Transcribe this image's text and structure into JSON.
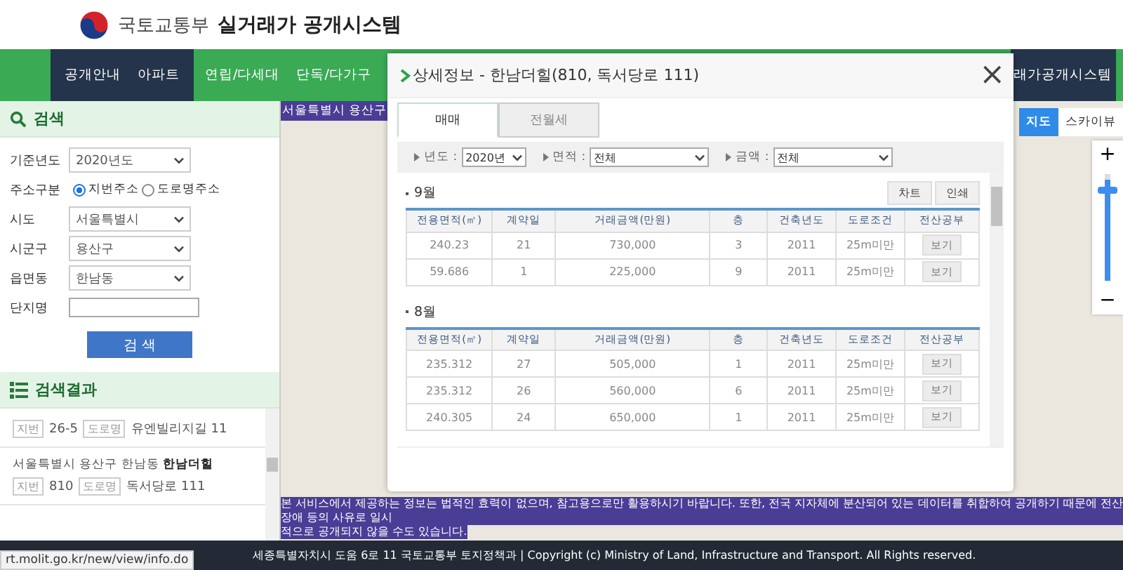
{
  "header": {
    "ministry": "국토교통부",
    "system": "실거래가 공개시스템"
  },
  "nav": {
    "items": [
      {
        "label": "공개안내",
        "selected": true
      },
      {
        "label": "아파트",
        "selected": true
      },
      {
        "label": "연립/다세대",
        "selected": false
      },
      {
        "label": "단독/다가구",
        "selected": false
      }
    ],
    "right_label": "래가공개시스템"
  },
  "search": {
    "title": "검색",
    "fields": [
      {
        "kind": "select",
        "label": "기준년도",
        "value": "2020년도"
      },
      {
        "kind": "radio",
        "label": "주소구분",
        "options": [
          {
            "label": "지번주소",
            "selected": true
          },
          {
            "label": "도로명주소",
            "selected": false
          }
        ]
      },
      {
        "kind": "select",
        "label": "시도",
        "value": "서울특별시"
      },
      {
        "kind": "select",
        "label": "시군구",
        "value": "용산구"
      },
      {
        "kind": "select",
        "label": "읍면동",
        "value": "한남동"
      },
      {
        "kind": "text",
        "label": "단지명"
      }
    ],
    "button": "검 색"
  },
  "results": {
    "title": "검색결과",
    "items": [
      {
        "lot_label": "지번",
        "lot": "26-5",
        "road_label": "도로명",
        "road": "유엔빌리지길 11"
      },
      {
        "address": "서울특별시 용산구 한남동 **한남더힐**",
        "lot_label": "지번",
        "lot": "810",
        "road_label": "도로명",
        "road": "독서당로 111"
      }
    ]
  },
  "map": {
    "top_notice": "서울특별시 용산구",
    "layer_tabs": [
      {
        "label": "지도",
        "selected": true
      },
      {
        "label": "스카이뷰",
        "selected": false
      }
    ],
    "zoom_in": "+",
    "zoom_out": "−",
    "zoom": {
      "level": 0.95
    },
    "disclaimer": [
      "본 서비스에서 제공하는 정보는 법적인 효력이 없으며, 참고용으로만 활용하시기 바랍니다. 또한, 전국 지자체에 분산되어 있는 데이터를 취합하여 공개하기 때문에 전산장애 등의 사유로 일시",
      "적으로 공개되지 않을 수도 있습니다."
    ]
  },
  "modal": {
    "title": "상세정보 - 한남더힐(810, 독서당로 111)",
    "close": "×",
    "tabs": [
      {
        "label": "매매",
        "selected": true
      },
      {
        "label": "전월세",
        "selected": false
      }
    ],
    "filters": [
      {
        "label": "년도 :",
        "value": "2020년"
      },
      {
        "label": "면적 :",
        "value": "전체"
      },
      {
        "label": "금액 :",
        "value": "전체"
      }
    ],
    "sections": [
      {
        "month": "9월",
        "buttons": [
          "차트",
          "인쇄"
        ],
        "columns": [
          "전용면적(㎡)",
          "계약일",
          "거래금액(만원)",
          "층",
          "건축년도",
          "도로조건",
          "전산공부"
        ],
        "rows": [
          {
            "cells": [
              "240.23",
              "21",
              "730,000",
              "3",
              "2011",
              "25m미만"
            ],
            "action": "보기"
          },
          {
            "cells": [
              "59.686",
              "1",
              "225,000",
              "9",
              "2011",
              "25m미만"
            ],
            "action": "보기"
          }
        ]
      },
      {
        "month": "8월",
        "columns": [
          "전용면적(㎡)",
          "계약일",
          "거래금액(만원)",
          "층",
          "건축년도",
          "도로조건",
          "전산공부"
        ],
        "rows": [
          {
            "cells": [
              "235.312",
              "27",
              "505,000",
              "1",
              "2011",
              "25m미만"
            ],
            "action": "보기"
          },
          {
            "cells": [
              "235.312",
              "26",
              "560,000",
              "6",
              "2011",
              "25m미만"
            ],
            "action": "보기"
          },
          {
            "cells": [
              "240.305",
              "24",
              "650,000",
              "1",
              "2011",
              "25m미만"
            ],
            "action": "보기"
          }
        ]
      }
    ]
  },
  "footer": {
    "text": "세종특별자치시 도움 6로 11 국토교통부 토지정책과 | Copyright (c) Ministry of Land, Infrastructure and Transport. All Rights reserved.",
    "status_url": "rt.molit.go.kr/new/view/info.do"
  }
}
